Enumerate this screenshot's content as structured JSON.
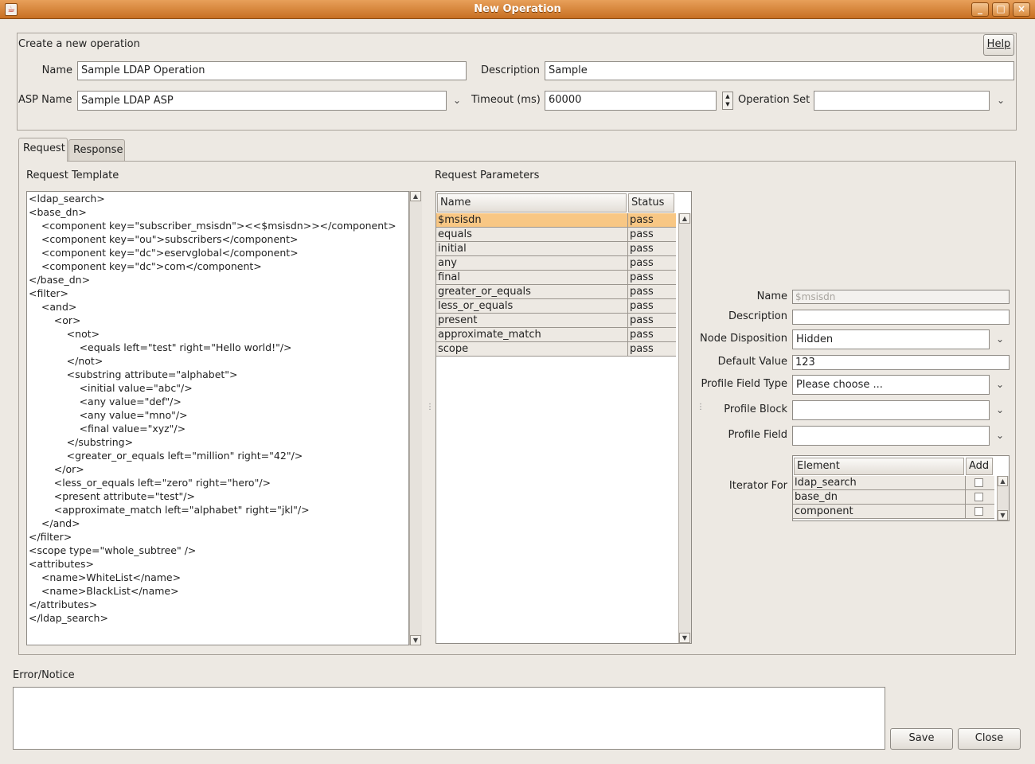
{
  "window": {
    "title": "New Operation",
    "app_icon": "java-cup-icon",
    "controls": {
      "minimize": "_",
      "maximize": "□",
      "close": "×"
    }
  },
  "header": {
    "section_label": "Create a new operation",
    "help_label": "Help",
    "name_label": "Name",
    "name_value": "Sample LDAP Operation",
    "description_label": "Description",
    "description_value": "Sample",
    "asp_label": "ASP Name",
    "asp_value": "Sample LDAP ASP",
    "timeout_label": "Timeout (ms)",
    "timeout_value": "60000",
    "operation_set_label": "Operation Set",
    "operation_set_value": ""
  },
  "tabs": [
    {
      "label": "Request",
      "active": true
    },
    {
      "label": "Response",
      "active": false
    }
  ],
  "request_template": {
    "label": "Request Template",
    "lines": [
      "<ldap_search>",
      "<base_dn>",
      "    <component key=\"subscriber_msisdn\"><<$msisdn>></component>",
      "    <component key=\"ou\">subscribers</component>",
      "    <component key=\"dc\">eservglobal</component>",
      "    <component key=\"dc\">com</component>",
      "</base_dn>",
      "<filter>",
      "    <and>",
      "        <or>",
      "            <not>",
      "                <equals left=\"test\" right=\"Hello world!\"/>",
      "            </not>",
      "            <substring attribute=\"alphabet\">",
      "                <initial value=\"abc\"/>",
      "                <any value=\"def\"/>",
      "                <any value=\"mno\"/>",
      "                <final value=\"xyz\"/>",
      "            </substring>",
      "            <greater_or_equals left=\"million\" right=\"42\"/>",
      "        </or>",
      "        <less_or_equals left=\"zero\" right=\"hero\"/>",
      "        <present attribute=\"test\"/>",
      "        <approximate_match left=\"alphabet\" right=\"jkl\"/>",
      "    </and>",
      "</filter>",
      "<scope type=\"whole_subtree\" />",
      "<attributes>",
      "    <name>WhiteList</name>",
      "    <name>BlackList</name>",
      "</attributes>",
      "</ldap_search>"
    ]
  },
  "request_parameters": {
    "label": "Request Parameters",
    "columns": [
      "Name",
      "Status"
    ],
    "rows": [
      {
        "name": "$msisdn",
        "status": "pass",
        "selected": true
      },
      {
        "name": "equals",
        "status": "pass"
      },
      {
        "name": "initial",
        "status": "pass"
      },
      {
        "name": "any",
        "status": "pass"
      },
      {
        "name": "final",
        "status": "pass"
      },
      {
        "name": "greater_or_equals",
        "status": "pass"
      },
      {
        "name": "less_or_equals",
        "status": "pass"
      },
      {
        "name": "present",
        "status": "pass"
      },
      {
        "name": "approximate_match",
        "status": "pass"
      },
      {
        "name": "scope",
        "status": "pass"
      }
    ]
  },
  "details": {
    "name_label": "Name",
    "name_value": "$msisdn",
    "description_label": "Description",
    "description_value": "",
    "node_disposition_label": "Node Disposition",
    "node_disposition_value": "Hidden",
    "default_value_label": "Default Value",
    "default_value_value": "123",
    "profile_field_type_label": "Profile Field Type",
    "profile_field_type_value": "Please choose ...",
    "profile_block_label": "Profile Block",
    "profile_block_value": "",
    "profile_field_label": "Profile Field",
    "profile_field_value": "",
    "iterator_label": "Iterator For",
    "iterator_columns": [
      "Element",
      "Add"
    ],
    "iterator_rows": [
      {
        "element": "ldap_search",
        "add": false
      },
      {
        "element": "base_dn",
        "add": false
      },
      {
        "element": "component",
        "add": false
      }
    ]
  },
  "footer": {
    "error_label": "Error/Notice",
    "error_text": "",
    "save_label": "Save",
    "close_label": "Close"
  }
}
